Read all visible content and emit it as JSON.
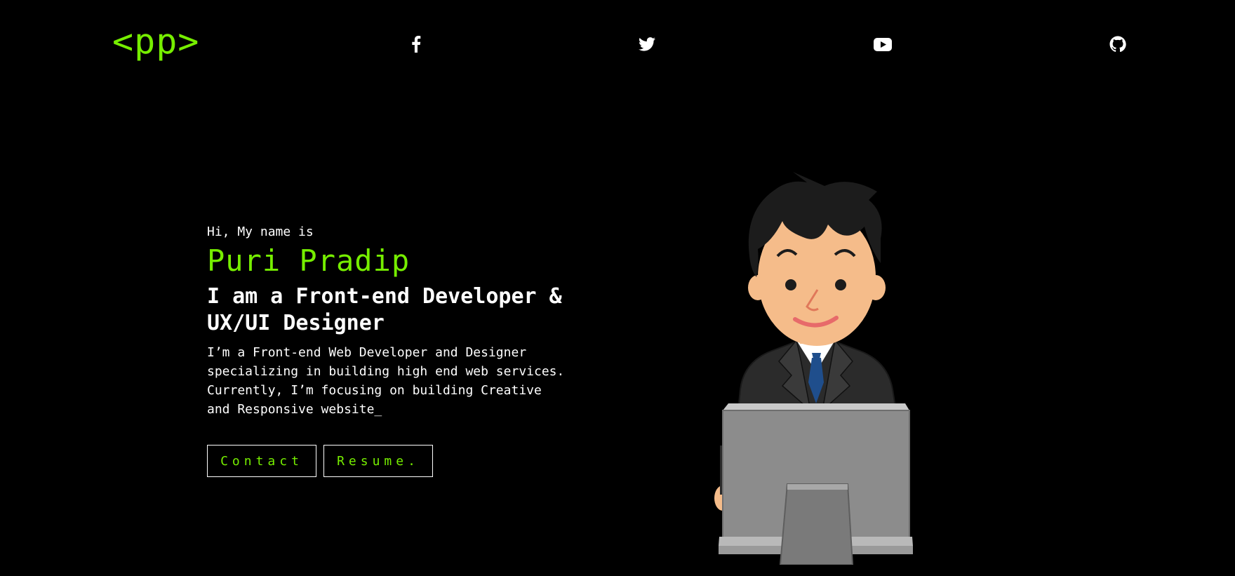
{
  "nav": {
    "logo": "<pp>",
    "social": [
      {
        "name": "facebook-icon"
      },
      {
        "name": "twitter-icon"
      },
      {
        "name": "youtube-icon"
      },
      {
        "name": "github-icon"
      }
    ]
  },
  "hero": {
    "greeting": "Hi, My name is",
    "name": "Puri Pradip",
    "role": "I am a Front-end Developer & UX/UI Designer",
    "description": "I’m a Front-end Web Developer and Designer specializing in building high end web services. Currently, I’m focusing on building Creative and Responsive website",
    "cursor": "_"
  },
  "buttons": {
    "contact": "Contact",
    "resume": "Resume."
  },
  "colors": {
    "background": "#000000",
    "accent": "#76ee00",
    "text": "#ffffff"
  }
}
